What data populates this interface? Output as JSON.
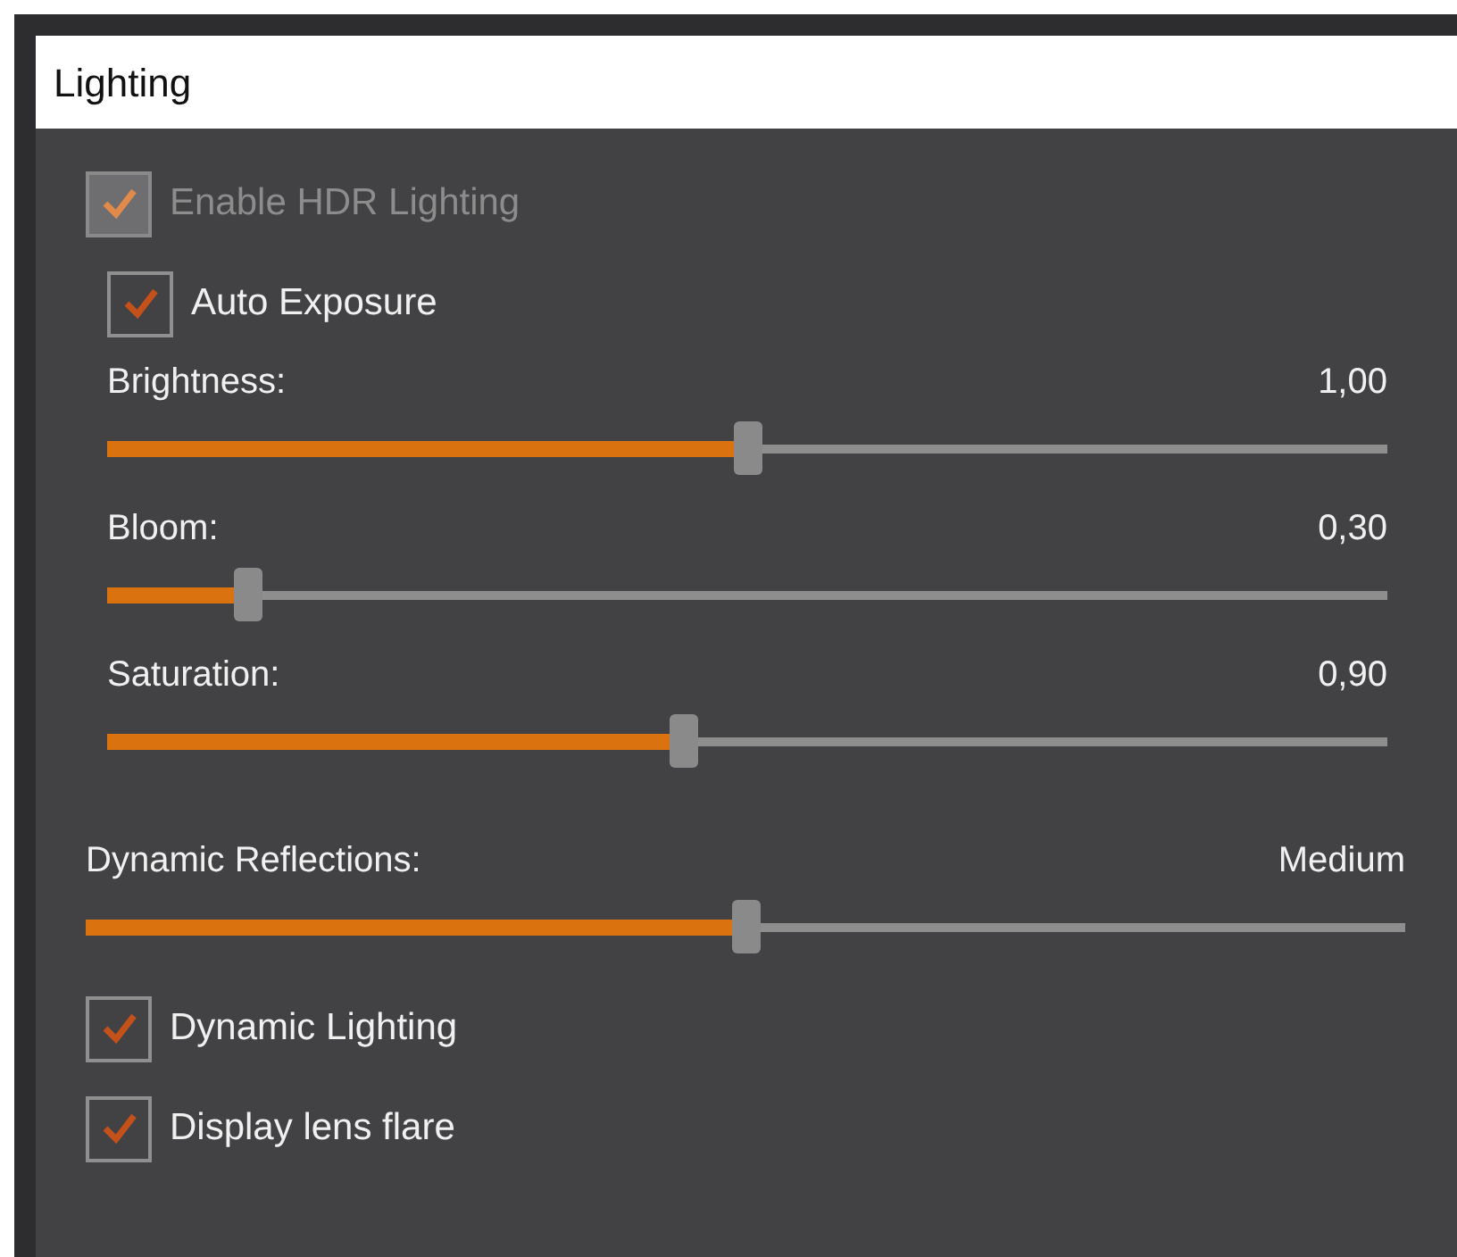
{
  "panel": {
    "title": "Lighting"
  },
  "items": [
    {
      "kind": "checkbox",
      "label": "Enable HDR Lighting",
      "checked": true,
      "disabled": true,
      "children": [
        {
          "kind": "checkbox",
          "label": "Auto Exposure",
          "checked": true,
          "disabled": false
        },
        {
          "kind": "slider",
          "label": "Brightness:",
          "reading": "1,00",
          "level": 0.5
        },
        {
          "kind": "slider",
          "label": "Bloom:",
          "reading": "0,30",
          "level": 0.11
        },
        {
          "kind": "slider",
          "label": "Saturation:",
          "reading": "0,90",
          "level": 0.45
        }
      ]
    },
    {
      "kind": "slider",
      "label": "Dynamic Reflections:",
      "reading": "Medium",
      "level": 0.5
    },
    {
      "kind": "checkbox",
      "label": "Dynamic Lighting",
      "checked": true,
      "disabled": false
    },
    {
      "kind": "checkbox",
      "label": "Display lens flare",
      "checked": true,
      "disabled": false
    }
  ]
}
